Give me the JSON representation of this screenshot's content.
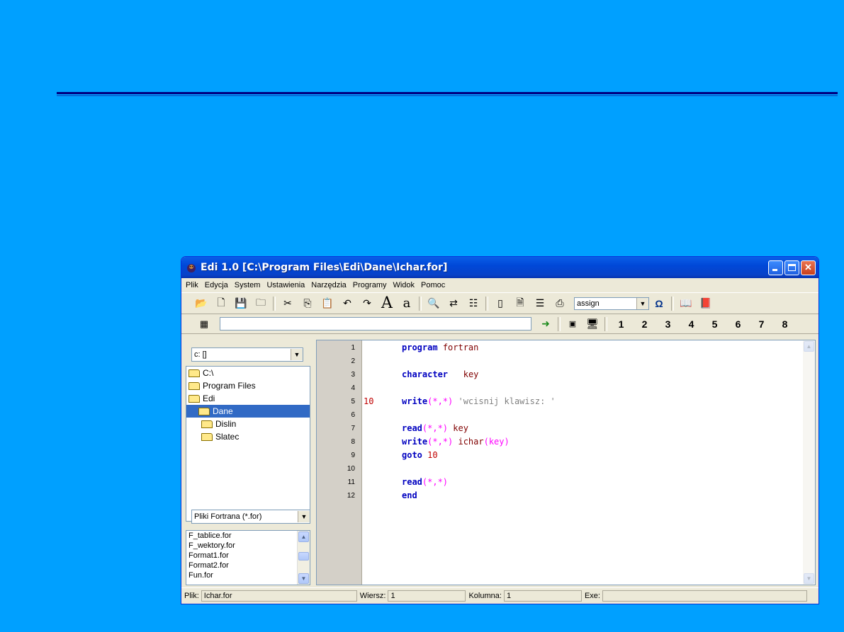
{
  "window": {
    "title": "Edi 1.0 [C:\\Program Files\\Edi\\Dane\\Ichar.for]"
  },
  "menu": [
    "Plik",
    "Edycja",
    "System",
    "Ustawienia",
    "Narzędzia",
    "Programy",
    "Widok",
    "Pomoc"
  ],
  "toolbar": {
    "keyword_combo": "assign"
  },
  "toolbar2": {
    "numbers": [
      "1",
      "2",
      "3",
      "4",
      "5",
      "6",
      "7",
      "8"
    ]
  },
  "explorer": {
    "drive": "c: []",
    "tree": [
      {
        "label": "C:\\",
        "indent": 0,
        "open": true
      },
      {
        "label": "Program Files",
        "indent": 0,
        "open": true
      },
      {
        "label": "Edi",
        "indent": 0,
        "open": true
      },
      {
        "label": "Dane",
        "indent": 1,
        "open": true,
        "selected": true
      },
      {
        "label": "Dislin",
        "indent": 1,
        "open": false
      },
      {
        "label": "Slatec",
        "indent": 1,
        "open": false
      }
    ],
    "filter": "Pliki Fortrana (*.for)",
    "files": [
      "F_tablice.for",
      "F_wektory.for",
      "Format1.for",
      "Format2.for",
      "Fun.for"
    ]
  },
  "editor": {
    "line_numbers": [
      "1",
      "2",
      "3",
      "4",
      "5",
      "6",
      "7",
      "8",
      "9",
      "10",
      "11",
      "12"
    ],
    "label_line5": "10",
    "lines": {
      "l1": {
        "kw": "program",
        "id": "fortran"
      },
      "l3": {
        "kw": "character",
        "id": "key"
      },
      "l5": {
        "kw": "write",
        "par": "(*,*)",
        "str": "'wcisnij klawisz: '"
      },
      "l7": {
        "kw": "read",
        "par": "(*,*)",
        "id": "key"
      },
      "l8": {
        "kw": "write",
        "par": "(*,*)",
        "id": "ichar",
        "par2": "(key)"
      },
      "l9": {
        "kw": "goto",
        "num": "10"
      },
      "l11": {
        "kw": "read",
        "par": "(*,*)"
      },
      "l12": {
        "kw": "end"
      }
    }
  },
  "statusbar": {
    "file_label": "Plik:",
    "file_value": "Ichar.for",
    "row_label": "Wiersz:",
    "row_value": "1",
    "col_label": "Kolumna:",
    "col_value": "1",
    "exe_label": "Exe:",
    "exe_value": ""
  },
  "colors": {
    "background": "#00A0FF",
    "titlebar": "#0048D8",
    "keyword": "#0000C0",
    "identifier": "#800000",
    "parens": "#FF00FF",
    "string": "#808080",
    "label": "#C00000"
  }
}
